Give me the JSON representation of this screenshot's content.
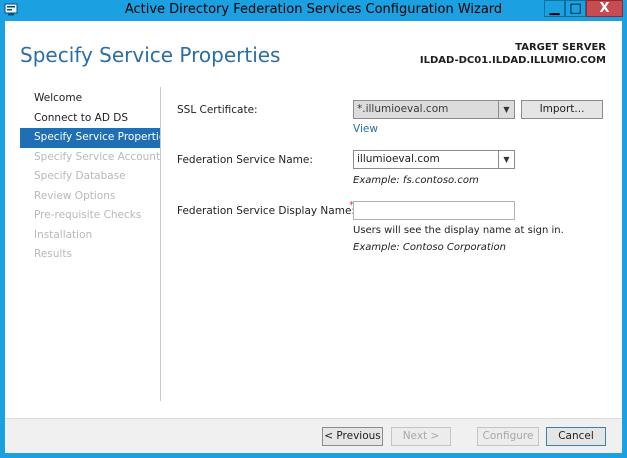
{
  "window": {
    "title": "Active Directory Federation Services Configuration Wizard",
    "minimize_glyph": "▁",
    "maximize_glyph": "□",
    "close_glyph": "X",
    "accent_color": "#1ba1e2"
  },
  "header": {
    "page_title": "Specify Service Properties",
    "target_label": "TARGET SERVER",
    "target_value": "ILDAD-DC01.ILDAD.ILLUMIO.COM"
  },
  "nav": {
    "items": [
      {
        "label": "Welcome",
        "state": "normal"
      },
      {
        "label": "Connect to AD DS",
        "state": "normal"
      },
      {
        "label": "Specify Service Properties",
        "state": "active"
      },
      {
        "label": "Specify Service Account",
        "state": "disabled"
      },
      {
        "label": "Specify Database",
        "state": "disabled"
      },
      {
        "label": "Review Options",
        "state": "disabled"
      },
      {
        "label": "Pre-requisite Checks",
        "state": "disabled"
      },
      {
        "label": "Installation",
        "state": "disabled"
      },
      {
        "label": "Results",
        "state": "disabled"
      }
    ]
  },
  "form": {
    "ssl_label": "SSL Certificate:",
    "ssl_value": "*.illumioeval.com",
    "import_label": "Import...",
    "view_label": "View",
    "fs_name_label": "Federation Service Name:",
    "fs_name_value": "illumioeval.com",
    "fs_name_example": "Example: fs.contoso.com",
    "display_name_label": "Federation Service Display Name:",
    "display_name_value": "",
    "required_marker": "*",
    "display_hint": "Users will see the display name at sign in.",
    "display_example": "Example: Contoso Corporation"
  },
  "footer": {
    "previous_label": "< Previous",
    "next_label": "Next >",
    "configure_label": "Configure",
    "cancel_label": "Cancel"
  }
}
